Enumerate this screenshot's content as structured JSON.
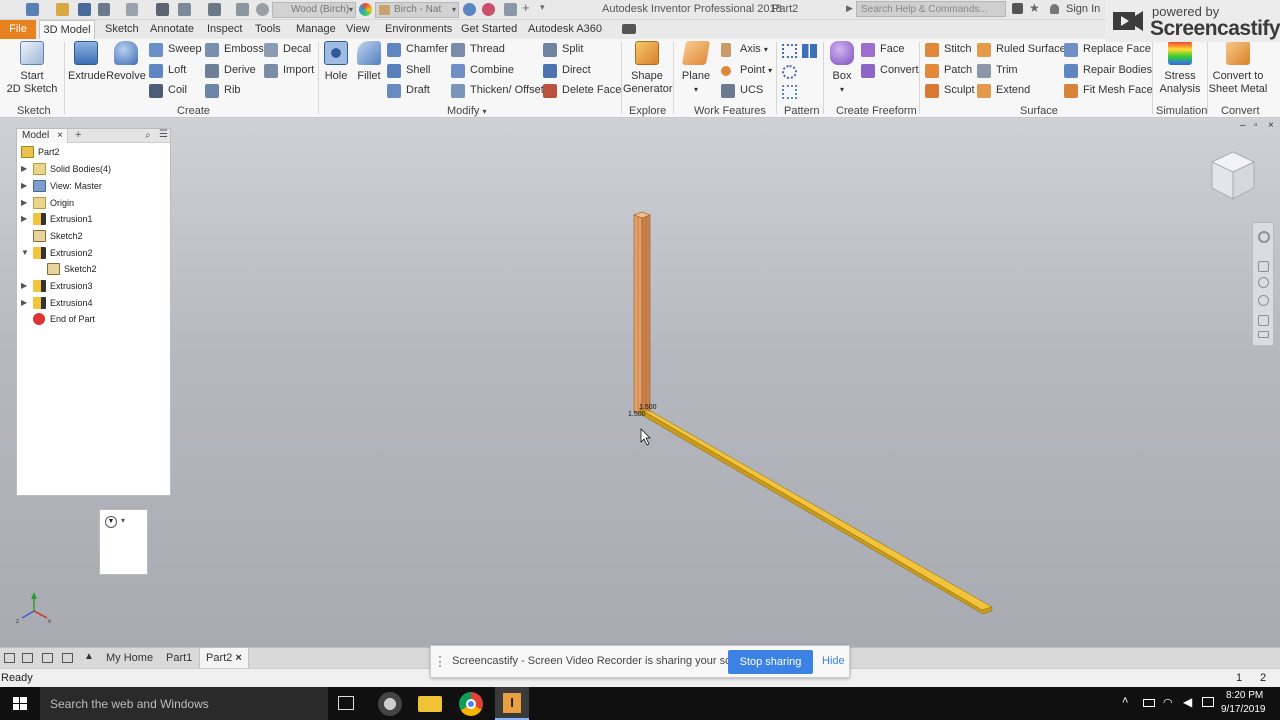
{
  "titlebar": {
    "material": "Wood (Birch)",
    "appearance": "Birch - Nat",
    "app_title": "Autodesk Inventor Professional 2018",
    "doc_title": "Part2",
    "search_placeholder": "Search Help & Commands...",
    "signin": "Sign In"
  },
  "screencastify": {
    "powered": "powered by",
    "brand": "Screencastify"
  },
  "tabs": [
    "File",
    "3D Model",
    "Sketch",
    "Annotate",
    "Inspect",
    "Tools",
    "Manage",
    "View",
    "Environments",
    "Get Started",
    "Autodesk A360"
  ],
  "ribbon": {
    "sketch": {
      "title": "Sketch",
      "start": "Start",
      "start2": "2D Sketch"
    },
    "create": {
      "title": "Create",
      "extrude": "Extrude",
      "revolve": "Revolve",
      "sweep": "Sweep",
      "emboss": "Emboss",
      "decal": "Decal",
      "loft": "Loft",
      "derive": "Derive",
      "import": "Import",
      "coil": "Coil",
      "rib": "Rib"
    },
    "modify": {
      "title": "Modify",
      "hole": "Hole",
      "fillet": "Fillet",
      "chamfer": "Chamfer",
      "thread": "Thread",
      "split": "Split",
      "shell": "Shell",
      "combine": "Combine",
      "direct": "Direct",
      "draft": "Draft",
      "thicken": "Thicken/ Offset",
      "delete_face": "Delete Face"
    },
    "explore": {
      "title": "Explore",
      "shape1": "Shape",
      "shape2": "Generator"
    },
    "work": {
      "title": "Work Features",
      "plane": "Plane",
      "axis": "Axis",
      "point": "Point",
      "ucs": "UCS"
    },
    "pattern": {
      "title": "Pattern"
    },
    "freeform": {
      "title": "Create Freeform",
      "box": "Box",
      "face": "Face",
      "convert": "Convert"
    },
    "surface": {
      "title": "Surface",
      "stitch": "Stitch",
      "ruled": "Ruled Surface",
      "replace": "Replace Face",
      "patch": "Patch",
      "trim": "Trim",
      "repair": "Repair Bodies",
      "sculpt": "Sculpt",
      "extend": "Extend",
      "fitmesh": "Fit Mesh Face"
    },
    "simulation": {
      "title": "Simulation",
      "stress1": "Stress",
      "stress2": "Analysis"
    },
    "convert": {
      "title": "Convert",
      "c1": "Convert to",
      "c2": "Sheet Metal"
    }
  },
  "browser": {
    "tab": "Model",
    "items": [
      {
        "label": "Part2",
        "icon": "part-icon"
      },
      {
        "label": "Solid Bodies(4)",
        "icon": "folder-icon"
      },
      {
        "label": "View: Master",
        "icon": "view-icon"
      },
      {
        "label": "Origin",
        "icon": "folder-icon"
      },
      {
        "label": "Extrusion1",
        "icon": "extrusion-icon"
      },
      {
        "label": "Sketch2",
        "icon": "sketch-icon"
      },
      {
        "label": "Extrusion2",
        "icon": "extrusion-icon"
      },
      {
        "label": "Sketch2",
        "icon": "sketch-icon"
      },
      {
        "label": "Extrusion3",
        "icon": "extrusion-icon"
      },
      {
        "label": "Extrusion4",
        "icon": "extrusion-icon"
      },
      {
        "label": "End of Part",
        "icon": "end-of-part-icon"
      }
    ]
  },
  "viewport": {
    "dim1": "1.500",
    "dim2": "1.500"
  },
  "doc_tabs": [
    "My Home",
    "Part1",
    "Part2"
  ],
  "status": {
    "text": "Ready",
    "n1": "1",
    "n2": "2"
  },
  "share": {
    "message": "Screencastify - Screen Video Recorder is sharing your screen.",
    "stop": "Stop sharing",
    "hide": "Hide"
  },
  "taskbar": {
    "search": "Search the web and Windows",
    "time": "8:20 PM",
    "date": "9/17/2019"
  },
  "colors": {
    "file_tab": "#e8811f",
    "wood": "#e8a26a",
    "wood_yellow": "#f0c23a",
    "share_button": "#3b82e4"
  }
}
